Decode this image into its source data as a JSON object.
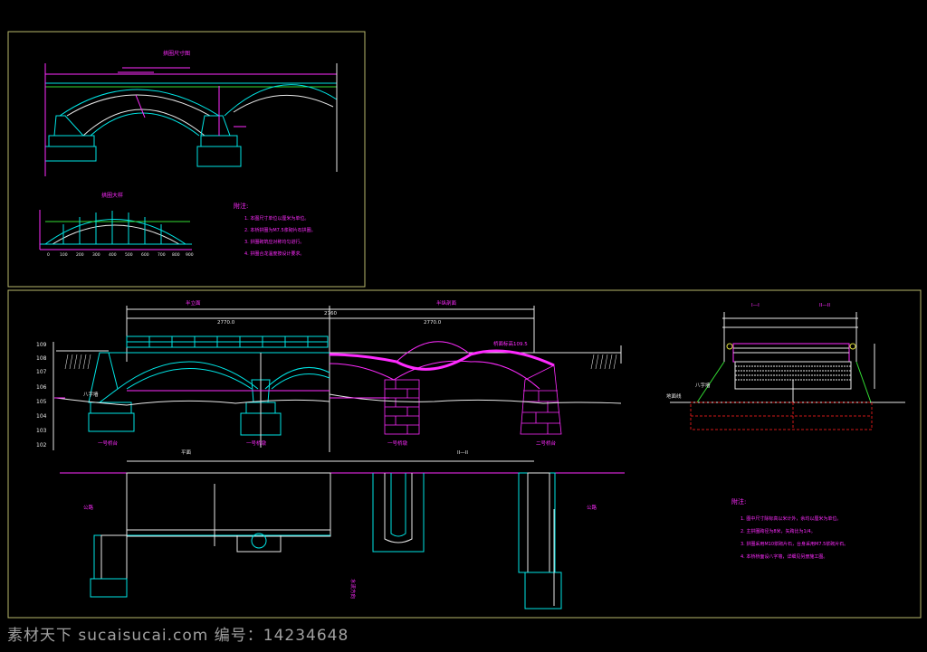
{
  "colors": {
    "frame": "#b9b96b",
    "cyan": "#00e5e5",
    "magenta": "#ff2bff",
    "white": "#e8e8e8",
    "green": "#33dd33",
    "red": "#d01818",
    "yellow": "#e0e040"
  },
  "top_panel": {
    "elevation_title": "拱圈尺寸图",
    "section_title": "拱圈大样",
    "notes_title": "附注:",
    "notes": [
      "1. 本图尺寸单位以厘米为单位。",
      "2. 本桥拱圈为M7.5浆砌片石拱圈。",
      "3. 拱圈砌筑应对称均匀进行。",
      "4. 拱圈合龙温度按设计要求。"
    ],
    "scale_ticks": [
      "0",
      "100",
      "200",
      "300",
      "400",
      "500",
      "600",
      "700",
      "800",
      "900"
    ]
  },
  "main_panel": {
    "half_elevation": "半立面",
    "half_section": "半纵剖面",
    "total_length": "2760",
    "half_length_left": "2770.0",
    "half_length_right": "2770.0",
    "elevations": [
      "109",
      "108",
      "107",
      "106",
      "105",
      "104",
      "103",
      "102"
    ],
    "labels": {
      "left_abut": "一号桥台",
      "pier1": "一号桥墩",
      "pier2": "一号桥墩",
      "right_abut": "二号桥台",
      "deck_elev": "桥面标高109.5",
      "wing_wall": "八字墙",
      "plan_title": "平面",
      "plan_section": "II—II",
      "road_left": "公路",
      "road_right": "公路",
      "sec_1": "I—I",
      "sec_2": "II—II",
      "cross_wing": "八字墙",
      "cross_ground": "地面线",
      "flow_dir": "水流方向"
    },
    "notes_title": "附注:",
    "notes": [
      "1. 图中尺寸除标高以米计外，余均以厘米为单位。",
      "2. 主拱圈跨径为8米，矢跨比为1/4。",
      "3. 拱圈采用M10浆砌片石，台身采用M7.5浆砌片石。",
      "4. 本桥桥面设八字墙，详细见另册施工图。"
    ]
  },
  "watermark": {
    "text": "素材天下 sucaisucai.com  编号：14234648"
  }
}
